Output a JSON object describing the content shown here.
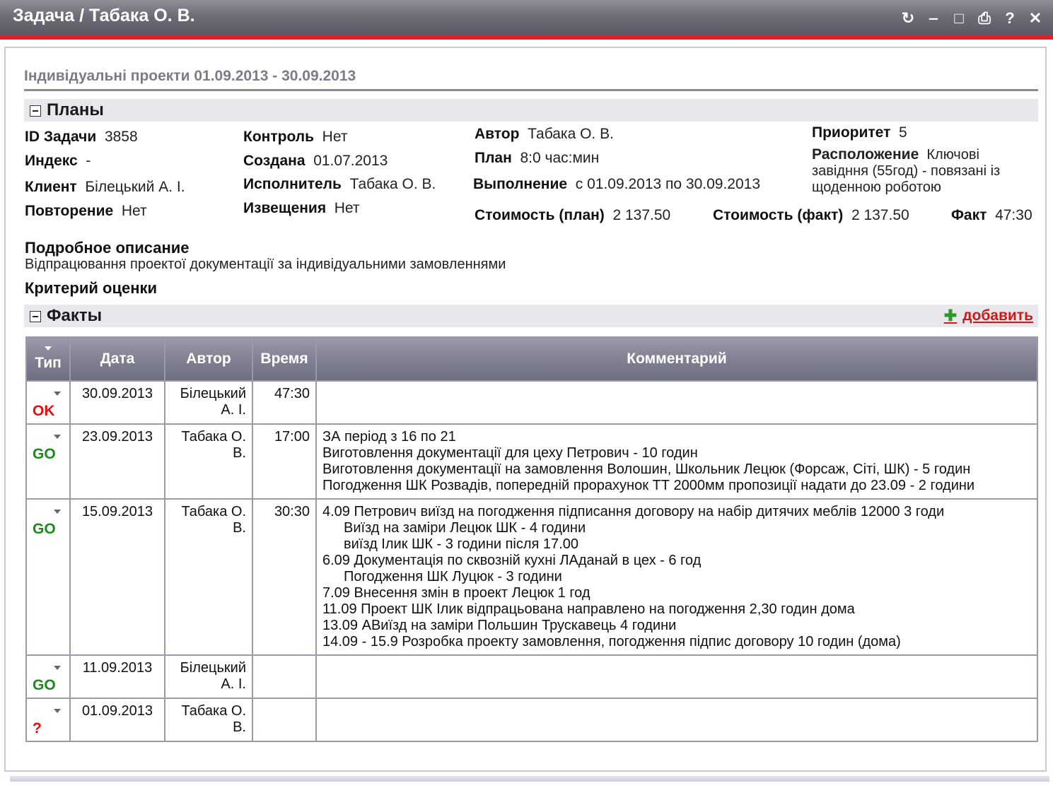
{
  "window": {
    "title": "Задача / Табака О. В.",
    "buttons": [
      "refresh-icon",
      "minimize-icon",
      "maximize-icon",
      "print-icon",
      "help-icon",
      "close-icon"
    ]
  },
  "subtitle": "Індивідуальні проекти 01.09.2013 - 30.09.2013",
  "plans": {
    "section_title": "Планы",
    "id_label": "ID Задачи",
    "id_value": "3858",
    "index_label": "Индекс",
    "index_value": "-",
    "client_label": "Клиент",
    "client_value": "Білецький А. І.",
    "repeat_label": "Повторение",
    "repeat_value": "Нет",
    "control_label": "Контроль",
    "control_value": "Нет",
    "created_label": "Создана",
    "created_value": "01.07.2013",
    "executor_label": "Исполнитель",
    "executor_value": "Табака О. В.",
    "notify_label": "Извещения",
    "notify_value": "Нет",
    "author_label": "Автор",
    "author_value": "Табака О. В.",
    "plan_label": "План",
    "plan_value": "8:0  час:мин",
    "exec_label": "Выполнение",
    "exec_value": "с  01.09.2013  по  30.09.2013",
    "priority_label": "Приоритет",
    "priority_value": "5",
    "location_label": "Расположение",
    "location_value": "Ключові завідння (55год) - повязані із щоденною роботою",
    "cost_plan_label": "Стоимость (план)",
    "cost_plan_value": "2 137.50",
    "cost_fact_label": "Стоимость (факт)",
    "cost_fact_value": "2 137.50",
    "fact_label": "Факт",
    "fact_value": "47:30",
    "desc_label": "Подробное описание",
    "desc_value": "Відпрацювання проектої документації за індивідуальними замовленнями",
    "criteria_label": "Критерий оценки"
  },
  "facts": {
    "section_title": "Факты",
    "add_label": "добавить",
    "columns": [
      "Тип",
      "Дата",
      "Автор",
      "Время",
      "Комментарий"
    ],
    "rows": [
      {
        "type": "OK",
        "date": "30.09.2013",
        "author": "Білецький А. І.",
        "time": "47:30",
        "comment": []
      },
      {
        "type": "GO",
        "date": "23.09.2013",
        "author": "Табака О. В.",
        "time": "17:00",
        "comment": [
          "ЗА період з 16 по 21",
          "Виготовлення документації для цеху Петрович - 10 годин",
          "Виготовлення документації на замовлення Волошин, Школьник Лецюк (Форсаж, Сіті, ШК) - 5 годин",
          "Погодження ШК Розвадів, попередній прорахунок ТТ 2000мм пропозиції надати до 23.09 - 2 години"
        ]
      },
      {
        "type": "GO",
        "date": "15.09.2013",
        "author": "Табака О. В.",
        "time": "30:30",
        "comment": [
          "4.09 Петрович виїзд на погодження підписання договору на набір дитячих меблів 12000 3 годи",
          "Виїзд на заміри Лецюк ШК - 4 години",
          "виїзд Ілик ШК - 3 години після 17.00",
          "6.09 Документація по сквозній кухні ЛАданай  в цех - 6 год",
          "Погодження ШК Луцюк - 3 години",
          "7.09 Внесення змін в проект Лецюк 1 год",
          "11.09 Проект ШК Ілик відпрацьована направлено на погодження 2,30 годин дома",
          "13.09 АВиїзд на заміри Польшин Трускавець 4 години",
          "14.09 - 15.9 Розробка проекту замовлення, погодження підпис договору 10 годин (дома)"
        ]
      },
      {
        "type": "GO",
        "date": "11.09.2013",
        "author": "Білецький А. І.",
        "time": "",
        "comment": []
      },
      {
        "type": "?",
        "date": "01.09.2013",
        "author": "Табака О. В.",
        "time": "",
        "comment": []
      }
    ]
  }
}
